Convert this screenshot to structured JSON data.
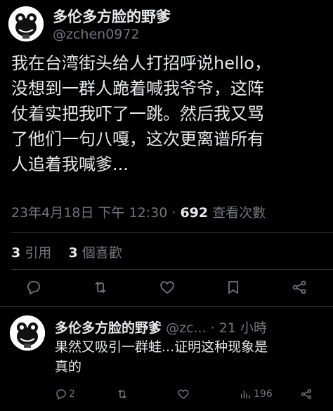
{
  "main_tweet": {
    "display_name": "多伦多方脸的野爹",
    "handle": "@zchen0972",
    "lines": [
      "我在台湾街头给人打招呼说hello，",
      "没想到一群人跪着喊我爷爷，这阵",
      "仗着实把我吓了一跳。然后我又骂",
      "了他们一句八嘎，这次更离谱所有",
      "人追着我喊爹..."
    ],
    "date": "23年4月18日",
    "time": "下午 12:30",
    "separator": "·",
    "views_count": "692",
    "views_label": "查看次數",
    "quotes_count": "3",
    "quotes_label": "引用",
    "likes_count": "3",
    "likes_label": "個喜歡"
  },
  "reply": {
    "display_name": "多伦多方脸的野爹",
    "handle": "@zc...",
    "separator": "·",
    "time": "21 小時",
    "lines": [
      "果然又吸引一群蛙...证明这种现象是",
      "真的"
    ],
    "reply_count": "2",
    "views_count": "196"
  },
  "icons": {
    "reply": "reply-icon",
    "retweet": "retweet-icon",
    "like": "heart-icon",
    "bookmark": "bookmark-icon",
    "share": "share-icon",
    "more": "more-icon",
    "views": "views-icon"
  }
}
